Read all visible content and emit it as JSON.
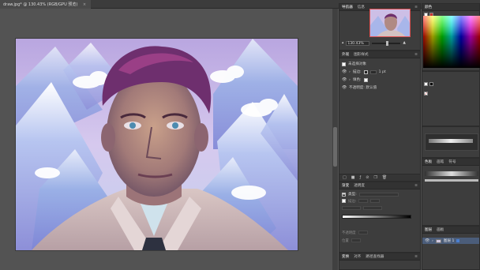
{
  "document": {
    "tab_title": "draw.jpg* @ 130.43% (RGB/GPU 预览)",
    "close_glyph": "×"
  },
  "navigator": {
    "tabs": [
      "导航器",
      "信息"
    ],
    "zoom_value": "130.43%"
  },
  "appearance": {
    "tabs": [
      "外观",
      "图形样式"
    ],
    "rows": [
      {
        "label": "未选择对象"
      },
      {
        "label": "描边:",
        "value": "1 pt"
      },
      {
        "label": "填色:"
      },
      {
        "label": "不透明度: 默认值"
      }
    ]
  },
  "color": {
    "tabs": [
      "颜色"
    ]
  },
  "swatches": {
    "tabs": [
      "色板",
      "画笔",
      "符号"
    ]
  },
  "gradient": {
    "tabs": [
      "渐变",
      "透明度"
    ],
    "type_label": "类型:",
    "stroke_label": "描边:",
    "opacity_label": "不透明度",
    "position_label": "位置"
  },
  "layers": {
    "tabs": [
      "图层",
      "画板"
    ],
    "items": [
      {
        "name": "图层 1"
      }
    ]
  },
  "bottom_panel": {
    "tabs": [
      "变换",
      "对齐",
      "路径查找器"
    ]
  },
  "icons": {
    "eye": "👁",
    "menu": "≡",
    "arrow": "›"
  }
}
